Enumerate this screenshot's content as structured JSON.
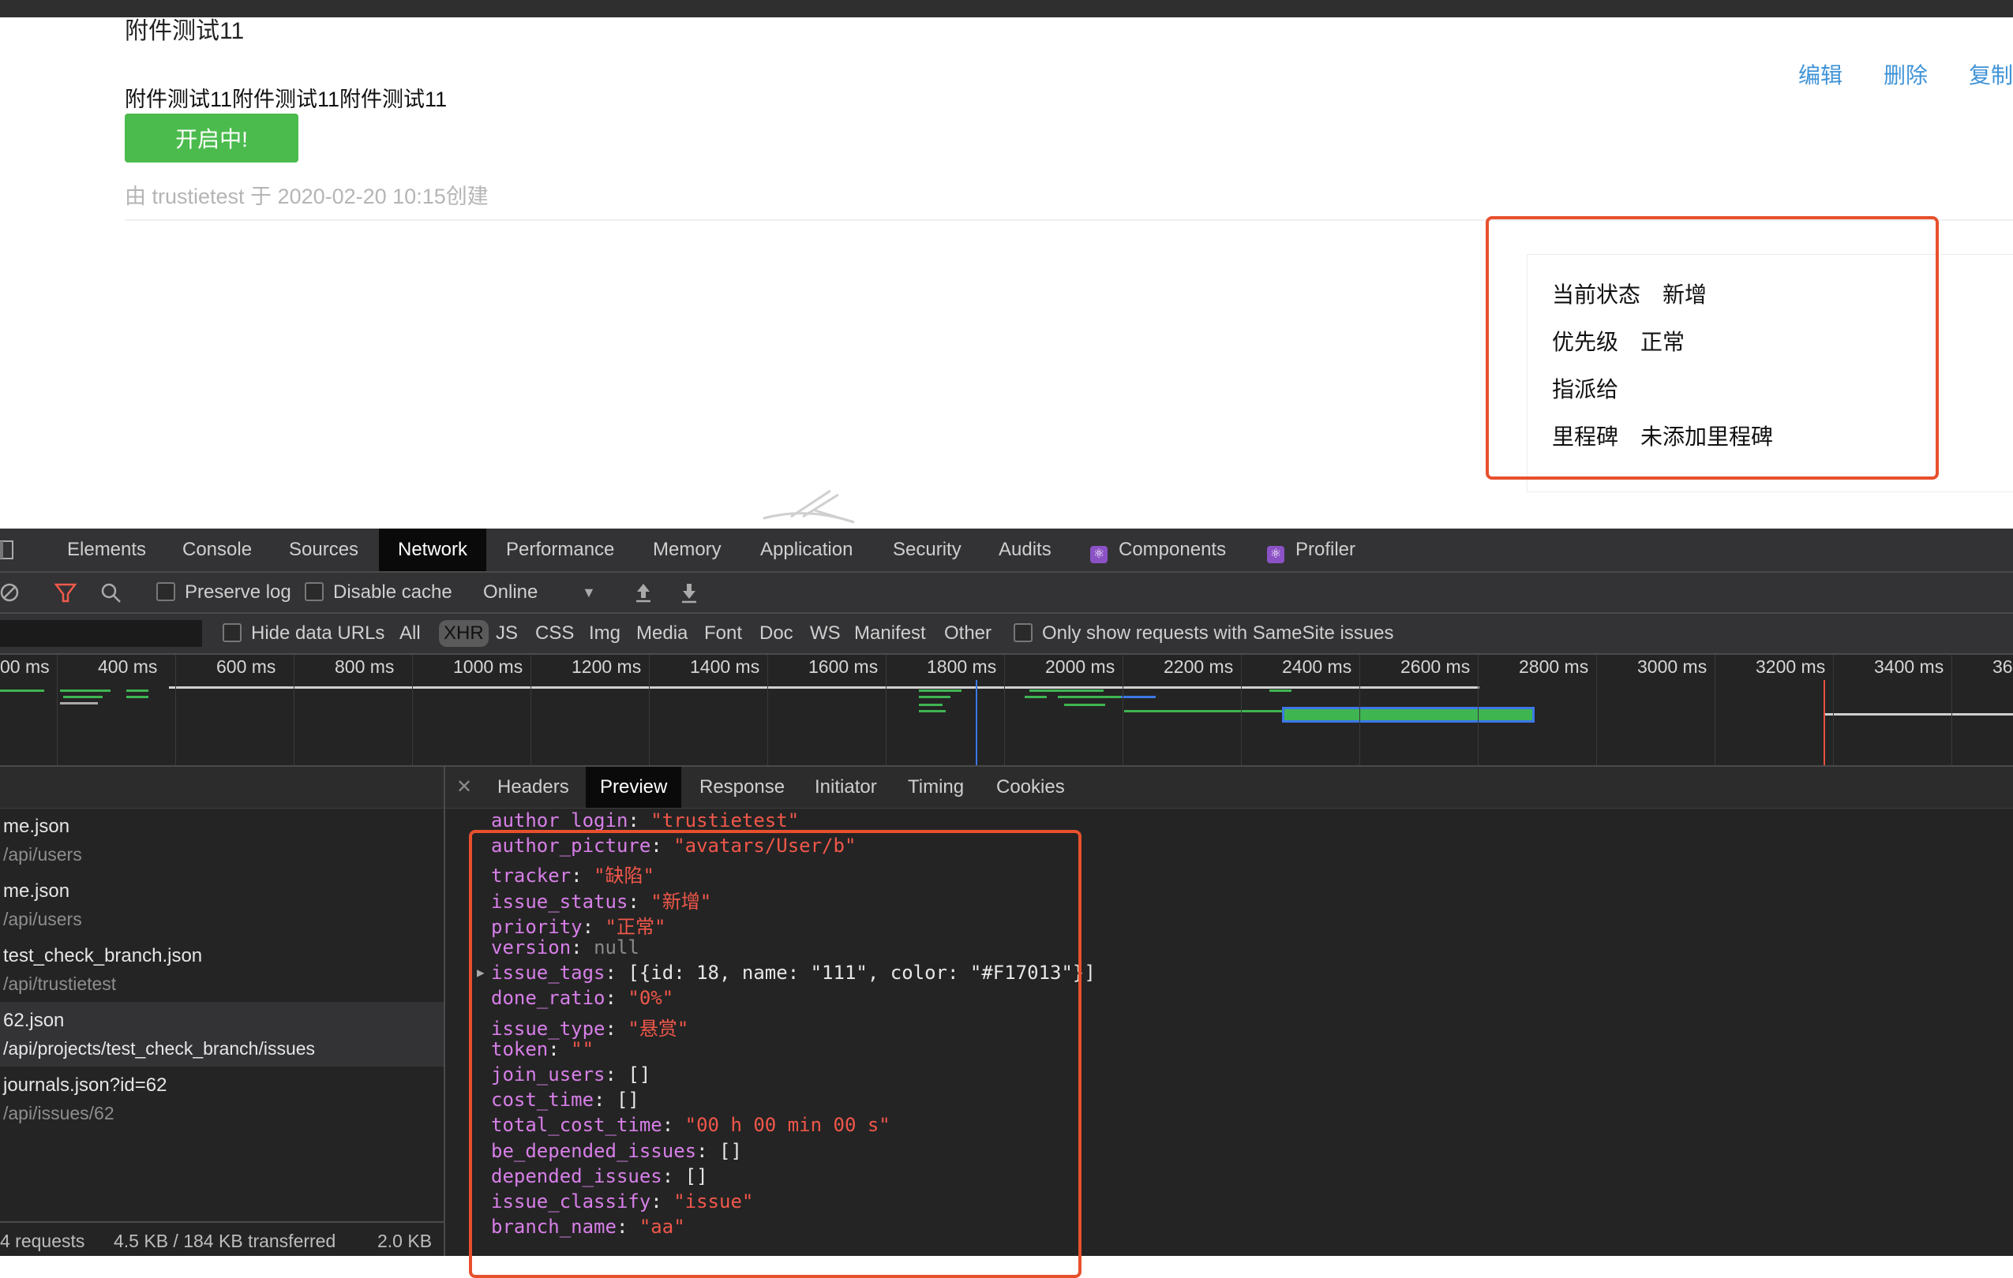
{
  "issue": {
    "title": "附件测试11",
    "description": "附件测试11附件测试11附件测试11",
    "status_button": "开启中!",
    "created_by": "由 trustietest 于 2020-02-20 10:15创建",
    "actions": [
      "编辑",
      "删除",
      "复制"
    ]
  },
  "info_panel": {
    "rows": [
      {
        "label": "当前状态",
        "value": "新增"
      },
      {
        "label": "优先级",
        "value": "正常"
      },
      {
        "label": "指派给",
        "value": ""
      },
      {
        "label": "里程碑",
        "value": "未添加里程碑"
      }
    ]
  },
  "devtools": {
    "tabs": [
      "Elements",
      "Console",
      "Sources",
      "Network",
      "Performance",
      "Memory",
      "Application",
      "Security",
      "Audits",
      "Components",
      "Profiler"
    ],
    "active_tab": "Network",
    "toolbar": {
      "preserve_log": "Preserve log",
      "disable_cache": "Disable cache",
      "throttling": "Online"
    },
    "filterbar": {
      "hide_data_urls": "Hide data URLs",
      "types": [
        "All",
        "XHR",
        "JS",
        "CSS",
        "Img",
        "Media",
        "Font",
        "Doc",
        "WS",
        "Manifest",
        "Other"
      ],
      "selected_type": "XHR",
      "samesite": "Only show requests with SameSite issues"
    },
    "timeline_ticks": [
      "00 ms",
      "400 ms",
      "600 ms",
      "800 ms",
      "1000 ms",
      "1200 ms",
      "1400 ms",
      "1600 ms",
      "1800 ms",
      "2000 ms",
      "2200 ms",
      "2400 ms",
      "2600 ms",
      "2800 ms",
      "3000 ms",
      "3200 ms",
      "3400 ms",
      "360"
    ],
    "requests": [
      {
        "name": "me.json",
        "path": "/api/users"
      },
      {
        "name": "me.json",
        "path": "/api/users"
      },
      {
        "name": "test_check_branch.json",
        "path": "/api/trustietest"
      },
      {
        "name": "62.json",
        "path": "/api/projects/test_check_branch/issues"
      },
      {
        "name": "journals.json?id=62",
        "path": "/api/issues/62"
      }
    ],
    "status": {
      "requests": "4 requests",
      "transferred": "4.5 KB / 184 KB transferred",
      "resources": "2.0 KB"
    },
    "detail_tabs": [
      "Headers",
      "Preview",
      "Response",
      "Initiator",
      "Timing",
      "Cookies"
    ],
    "active_detail_tab": "Preview",
    "preview_lines": [
      {
        "key": "author_login",
        "val": "\"trustietest\"",
        "type": "s"
      },
      {
        "key": "author_picture",
        "val": "\"avatars/User/b\"",
        "type": "s"
      },
      {
        "key": "tracker",
        "val": "\"缺陷\"",
        "type": "s"
      },
      {
        "key": "issue_status",
        "val": "\"新增\"",
        "type": "s"
      },
      {
        "key": "priority",
        "val": "\"正常\"",
        "type": "s"
      },
      {
        "key": "version",
        "val": "null",
        "type": "nul"
      },
      {
        "key": "issue_tags",
        "val": "[{id: 18, name: \"111\", color: \"#F17013\"}]",
        "type": "n",
        "expandable": true
      },
      {
        "key": "done_ratio",
        "val": "\"0%\"",
        "type": "s"
      },
      {
        "key": "issue_type",
        "val": "\"悬赏\"",
        "type": "s"
      },
      {
        "key": "token",
        "val": "\"\"",
        "type": "s"
      },
      {
        "key": "join_users",
        "val": "[]",
        "type": "n"
      },
      {
        "key": "cost_time",
        "val": "[]",
        "type": "n"
      },
      {
        "key": "total_cost_time",
        "val": "\"00 h 00 min 00 s\"",
        "type": "s"
      },
      {
        "key": "be_depended_issues",
        "val": "[]",
        "type": "n"
      },
      {
        "key": "depended_issues",
        "val": "[]",
        "type": "n"
      },
      {
        "key": "issue_classify",
        "val": "\"issue\"",
        "type": "s"
      },
      {
        "key": "branch_name",
        "val": "\"aa\"",
        "type": "s"
      }
    ]
  },
  "colors": {
    "status_green": "#4cbb4e",
    "link_blue": "#3f93d7",
    "highlight_red": "#e8502d",
    "json_key": "#d77fe8",
    "json_string": "#f0574a"
  }
}
